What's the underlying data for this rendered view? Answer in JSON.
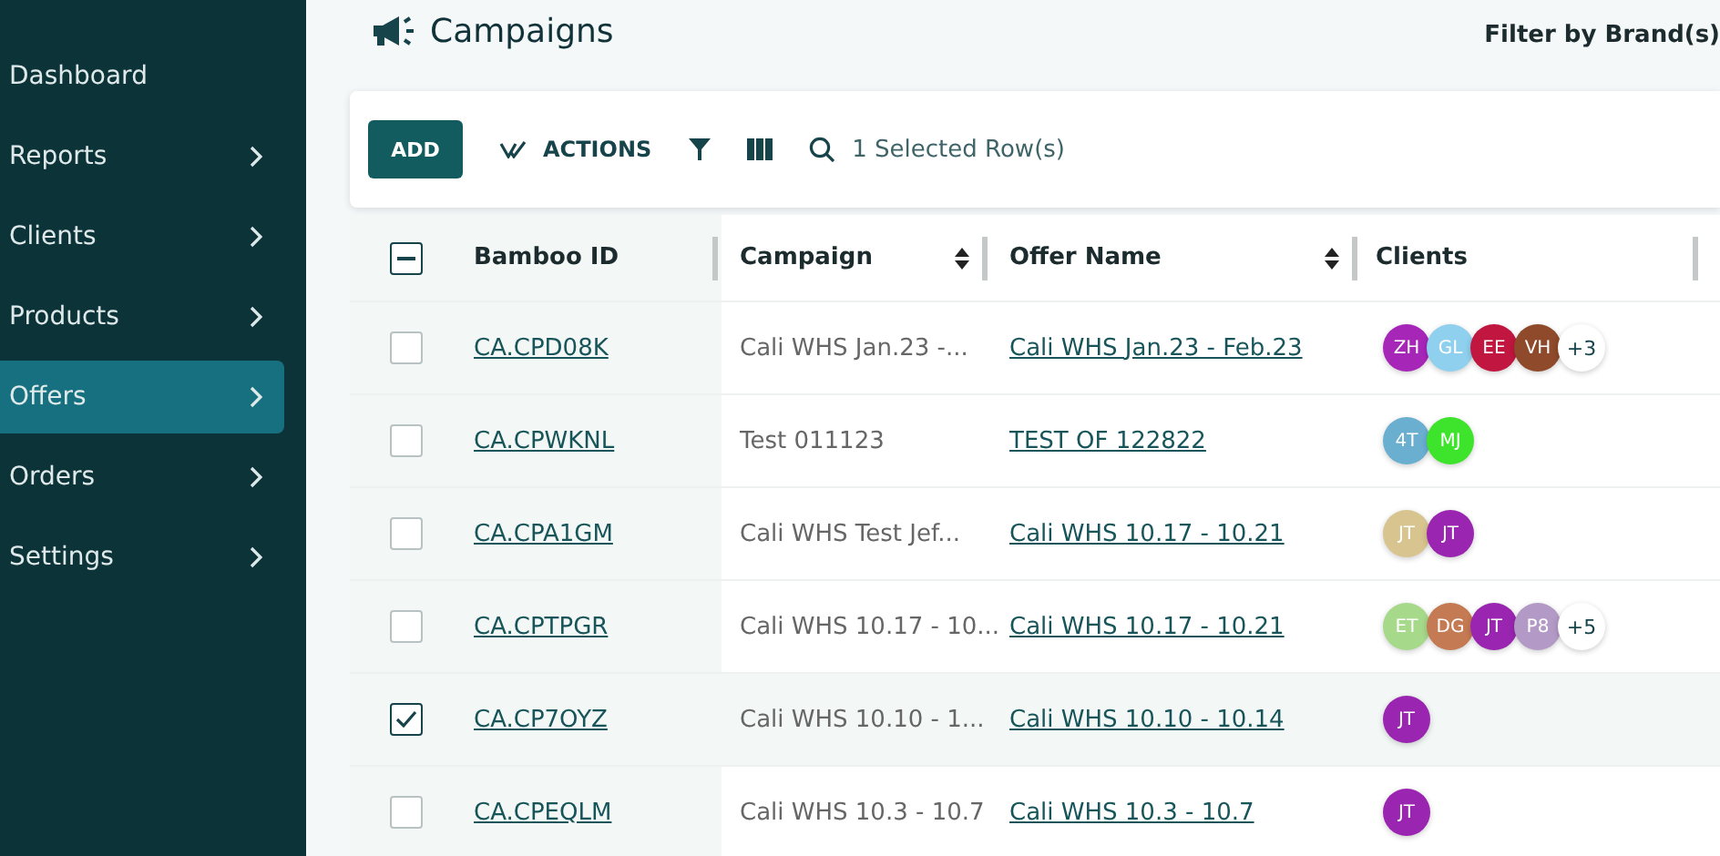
{
  "sidebar": {
    "items": [
      {
        "label": "Dashboard",
        "has_submenu": false,
        "selected": false
      },
      {
        "label": "Reports",
        "has_submenu": true,
        "selected": false
      },
      {
        "label": "Clients",
        "has_submenu": true,
        "selected": false
      },
      {
        "label": "Products",
        "has_submenu": true,
        "selected": false
      },
      {
        "label": "Offers",
        "has_submenu": true,
        "selected": true
      },
      {
        "label": "Orders",
        "has_submenu": true,
        "selected": false
      },
      {
        "label": "Settings",
        "has_submenu": true,
        "selected": false
      }
    ]
  },
  "header": {
    "title": "Campaigns",
    "filter_label": "Filter by Brand(s)"
  },
  "toolbar": {
    "add_button": "ADD",
    "actions_button": "ACTIONS",
    "selection_text": "1 Selected Row(s)"
  },
  "table": {
    "select_all": {
      "indeterminate": true
    },
    "columns": [
      {
        "label": "Bamboo ID",
        "sortable": false
      },
      {
        "label": "Campaign",
        "sortable": true
      },
      {
        "label": "Offer Name",
        "sortable": true
      },
      {
        "label": "Clients",
        "sortable": false
      }
    ],
    "rows": [
      {
        "selected": false,
        "bamboo_id": "CA.CPD08K",
        "campaign": "Cali WHS Jan.23 -...",
        "offer_name": "Cali WHS Jan.23 - Feb.23",
        "clients": [
          {
            "initials": "ZH",
            "color": "#a626b8"
          },
          {
            "initials": "GL",
            "color": "#8fd0ee"
          },
          {
            "initials": "EE",
            "color": "#c0163f"
          },
          {
            "initials": "VH",
            "color": "#8e4a2a"
          }
        ],
        "more": "+3"
      },
      {
        "selected": false,
        "bamboo_id": "CA.CPWKNL",
        "campaign": "Test 011123",
        "offer_name": "TEST OF 122822",
        "clients": [
          {
            "initials": "4T",
            "color": "#6aaed0"
          },
          {
            "initials": "MJ",
            "color": "#3ee42c"
          }
        ]
      },
      {
        "selected": false,
        "bamboo_id": "CA.CPA1GM",
        "campaign": "Cali WHS Test Jef...",
        "offer_name": "Cali WHS 10.17 - 10.21",
        "clients": [
          {
            "initials": "JT",
            "color": "#d8c48e"
          },
          {
            "initials": "JT",
            "color": "#9a25b0"
          }
        ]
      },
      {
        "selected": false,
        "bamboo_id": "CA.CPTPGR",
        "campaign": "Cali WHS 10.17 - 10...",
        "offer_name": "Cali WHS 10.17 - 10.21",
        "clients": [
          {
            "initials": "ET",
            "color": "#a6d98a"
          },
          {
            "initials": "DG",
            "color": "#c47a52"
          },
          {
            "initials": "JT",
            "color": "#9a25b0"
          },
          {
            "initials": "P8",
            "color": "#b39ac6"
          }
        ],
        "more": "+5"
      },
      {
        "selected": true,
        "bamboo_id": "CA.CP7OYZ",
        "campaign": "Cali WHS 10.10 - 1...",
        "offer_name": "Cali WHS 10.10 - 10.14",
        "clients": [
          {
            "initials": "JT",
            "color": "#9a25b0"
          }
        ]
      },
      {
        "selected": false,
        "bamboo_id": "CA.CPEQLM",
        "campaign": "Cali WHS 10.3 - 10.7",
        "offer_name": "Cali WHS 10.3 - 10.7",
        "clients": [
          {
            "initials": "JT",
            "color": "#9a25b0"
          }
        ]
      }
    ]
  }
}
